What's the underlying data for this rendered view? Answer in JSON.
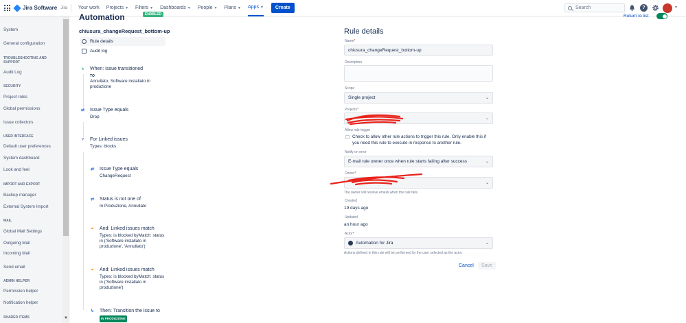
{
  "topnav": {
    "product": "Jira Software",
    "product_sub": "Jira",
    "items": [
      {
        "label": "Your work",
        "chevron": false
      },
      {
        "label": "Projects",
        "chevron": true
      },
      {
        "label": "Filters",
        "chevron": true
      },
      {
        "label": "Dashboards",
        "chevron": true
      },
      {
        "label": "People",
        "chevron": true
      },
      {
        "label": "Plans",
        "chevron": true
      },
      {
        "label": "Apps",
        "chevron": true,
        "active": true
      }
    ],
    "create_label": "Create",
    "search_placeholder": "Search",
    "help_icon": "question-icon",
    "settings_icon": "gear-icon",
    "notifications_icon": "bell-icon"
  },
  "sidebar": {
    "entries": [
      {
        "type": "item",
        "label": "System"
      },
      {
        "type": "item",
        "label": "General configuration"
      },
      {
        "type": "head",
        "label": "TROUBLESHOOTING AND SUPPORT"
      },
      {
        "type": "item",
        "label": "Audit Log"
      },
      {
        "type": "head",
        "label": "SECURITY"
      },
      {
        "type": "item",
        "label": "Project roles"
      },
      {
        "type": "item",
        "label": "Global permissions"
      },
      {
        "type": "item",
        "label": "Issue collectors"
      },
      {
        "type": "head",
        "label": "USER INTERFACE"
      },
      {
        "type": "item",
        "label": "Default user preferences"
      },
      {
        "type": "item",
        "label": "System dashboard"
      },
      {
        "type": "item",
        "label": "Look and feel"
      },
      {
        "type": "head",
        "label": "IMPORT AND EXPORT"
      },
      {
        "type": "item",
        "label": "Backup manager"
      },
      {
        "type": "item",
        "label": "External System Import"
      },
      {
        "type": "head",
        "label": "MAIL"
      },
      {
        "type": "item",
        "label": "Global Mail Settings"
      },
      {
        "type": "item",
        "label": "Outgoing Mail"
      },
      {
        "type": "item",
        "label": "Incoming Mail"
      },
      {
        "type": "item",
        "label": "Send email"
      },
      {
        "type": "head",
        "label": "ADMIN HELPER"
      },
      {
        "type": "item",
        "label": "Permission helper"
      },
      {
        "type": "item",
        "label": "Notification helper"
      },
      {
        "type": "head",
        "label": "SHARED ITEMS"
      }
    ]
  },
  "automation": {
    "title": "Automation",
    "status_badge": "ENABLED",
    "rule_name": "chiusura_changeRequest_bottom-up",
    "menu": [
      {
        "label": "Rule details",
        "icon": "info-icon",
        "selected": true
      },
      {
        "label": "Audit log",
        "icon": "document-icon",
        "selected": false
      }
    ],
    "steps": [
      {
        "kind": "trigger",
        "icon": "trigger-icon",
        "title": "When: Issue transitioned",
        "sub": "TO",
        "body": "Annullato, Software installato in produzione"
      },
      {
        "kind": "condition",
        "icon": "condition-icon",
        "title": "Issue Type equals",
        "body": "Drop"
      },
      {
        "kind": "branch",
        "icon": "branch-icon",
        "title": "For Linked issues",
        "body": "Types: blocks"
      },
      {
        "kind": "condition",
        "icon": "condition-icon",
        "title": "Issue Type equals",
        "body": "ChangeRequest"
      },
      {
        "kind": "condition",
        "icon": "condition-icon",
        "title": "Status is not one of",
        "body": "In Produzione, Annullato"
      },
      {
        "kind": "condition",
        "icon": "link-icon",
        "title": "And: Linked issues match",
        "body": "Types: is blocked byMatch: status in ('Software installato in produzione', 'Annullato')"
      },
      {
        "kind": "condition",
        "icon": "link-icon",
        "title": "And: Linked issues match",
        "body": "Types: is blocked byMatch: status in ('Software installato in produzione')"
      },
      {
        "kind": "action",
        "icon": "transition-icon",
        "title": "Then: Transition the issue to",
        "badge": "IN PRODUZIONE"
      }
    ]
  },
  "rule_details": {
    "title": "Rule details",
    "return_label": "Return to list",
    "name_label": "Name",
    "name_value": "chiusura_changeRequest_bottom-up",
    "description_label": "Description",
    "description_value": "",
    "scope_label": "Scope",
    "scope_value": "Single project",
    "projects_label": "Projects",
    "allow_trigger_label": "Allow rule trigger",
    "allow_trigger_text": "Check to allow other rule actions to trigger this rule. Only enable this if you need this rule to execute in response to another rule.",
    "allow_trigger_checked": false,
    "notify_label": "Notify on error",
    "notify_value": "E-mail rule owner once when rule starts failing after success",
    "owner_label": "Owner",
    "owner_helper": "The owner will receive emails when the rule fails.",
    "created_label": "Created",
    "created_value": "19 days ago",
    "updated_label": "Updated",
    "updated_value": "an hour ago",
    "actor_label": "Actor",
    "actor_value": "Automation for Jira",
    "actor_helper": "Actions defined in this rule will be performed by the user selected as the actor.",
    "cancel_label": "Cancel",
    "save_label": "Save"
  }
}
